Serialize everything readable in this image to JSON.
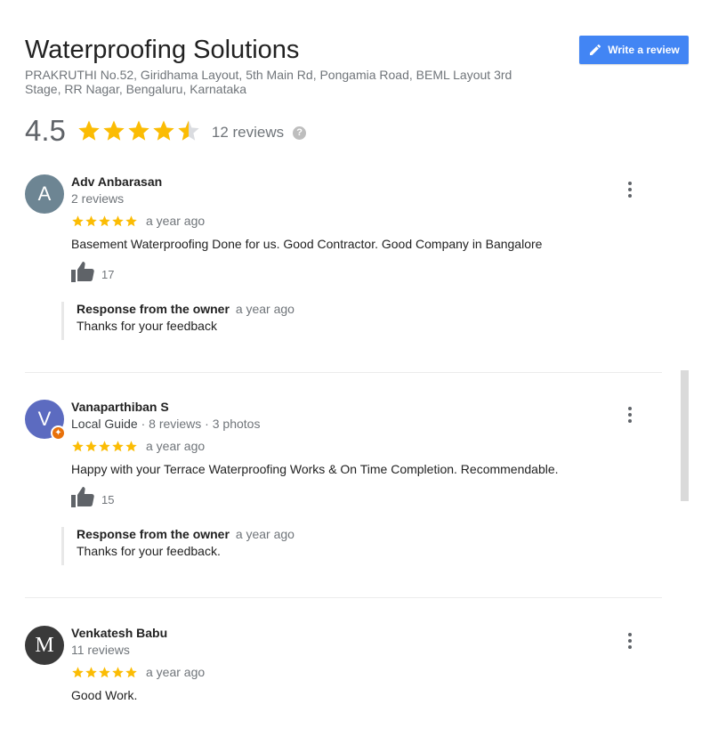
{
  "business": {
    "name": "Waterproofing Solutions",
    "address": "PRAKRUTHI No.52, Giridhama Layout, 5th Main Rd, Pongamia Road, BEML Layout 3rd Stage, RR Nagar, Bengaluru, Karnataka",
    "rating": "4.5",
    "rating_value": 4.5,
    "review_count": "12 reviews",
    "help_icon": "?"
  },
  "write_review": {
    "label": "Write a review",
    "icon": "pencil-icon"
  },
  "colors": {
    "star": "#fbbc04",
    "star_empty": "#dadce0",
    "button": "#4285f4",
    "badge": "#e8710a"
  },
  "reviews": [
    {
      "initial": "A",
      "avatar_color": "#6d8593",
      "name": "Adv Anbarasan",
      "meta": "2 reviews",
      "stars": 5,
      "when": "a year ago",
      "text": "Basement Waterproofing Done for us. Good Contractor. Good Company in Bangalore",
      "likes": "17",
      "response_label": "Response from the owner",
      "response_when": "a year ago",
      "response_text": "Thanks for your feedback"
    },
    {
      "initial": "V",
      "avatar_color": "#5c6bc0",
      "name": "Vanaparthiban S",
      "local_guide": "Local Guide",
      "meta": " · 8 reviews · 3 photos",
      "stars": 5,
      "when": "a year ago",
      "text": "Happy with your Terrace Waterproofing Works & On Time Completion. Recommendable.",
      "likes": "15",
      "response_label": "Response from the owner",
      "response_when": "a year ago",
      "response_text": "Thanks for your feedback."
    },
    {
      "initial": "M",
      "avatar_color": "#3a3a3a",
      "name": "Venkatesh Babu",
      "meta": "11 reviews",
      "stars": 5,
      "when": "a year ago",
      "text": "Good Work."
    }
  ]
}
